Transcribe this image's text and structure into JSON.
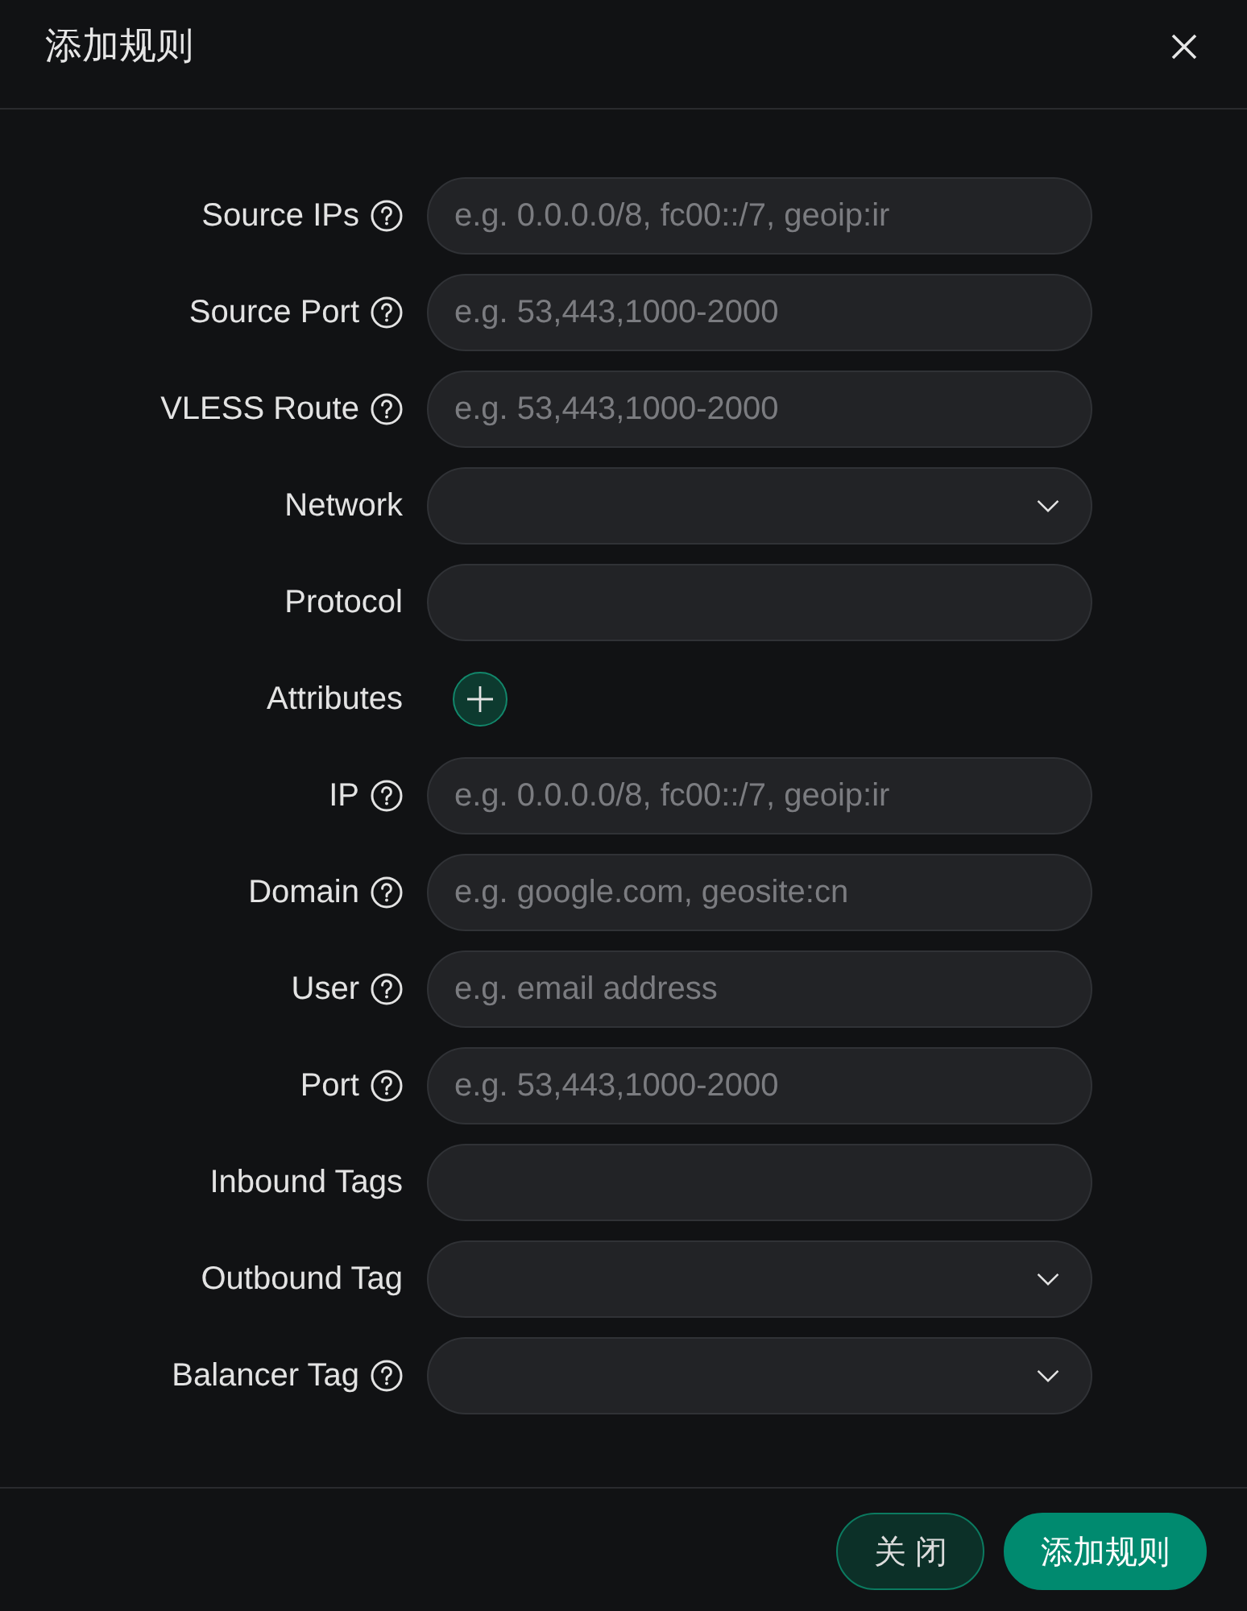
{
  "dialog": {
    "title": "添加规则"
  },
  "fields": [
    {
      "label": "Source IPs",
      "help": true,
      "kind": "input",
      "placeholder": "e.g. 0.0.0.0/8, fc00::/7, geoip:ir"
    },
    {
      "label": "Source Port",
      "help": true,
      "kind": "input",
      "placeholder": "e.g. 53,443,1000-2000"
    },
    {
      "label": "VLESS Route",
      "help": true,
      "kind": "input",
      "placeholder": "e.g. 53,443,1000-2000"
    },
    {
      "label": "Network",
      "help": false,
      "kind": "select"
    },
    {
      "label": "Protocol",
      "help": false,
      "kind": "input"
    },
    {
      "label": "Attributes",
      "help": false,
      "kind": "add"
    },
    {
      "label": "IP",
      "help": true,
      "kind": "input",
      "placeholder": "e.g. 0.0.0.0/8, fc00::/7, geoip:ir"
    },
    {
      "label": "Domain",
      "help": true,
      "kind": "input",
      "placeholder": "e.g. google.com, geosite:cn"
    },
    {
      "label": "User",
      "help": true,
      "kind": "input",
      "placeholder": "e.g. email address"
    },
    {
      "label": "Port",
      "help": true,
      "kind": "input",
      "placeholder": "e.g. 53,443,1000-2000"
    },
    {
      "label": "Inbound Tags",
      "help": false,
      "kind": "input"
    },
    {
      "label": "Outbound Tag",
      "help": false,
      "kind": "select"
    },
    {
      "label": "Balancer Tag",
      "help": true,
      "kind": "select"
    }
  ],
  "footer": {
    "buttons": [
      {
        "label": "关 闭",
        "kind": "secondary"
      },
      {
        "label": "添加规则",
        "kind": "primary"
      }
    ]
  }
}
